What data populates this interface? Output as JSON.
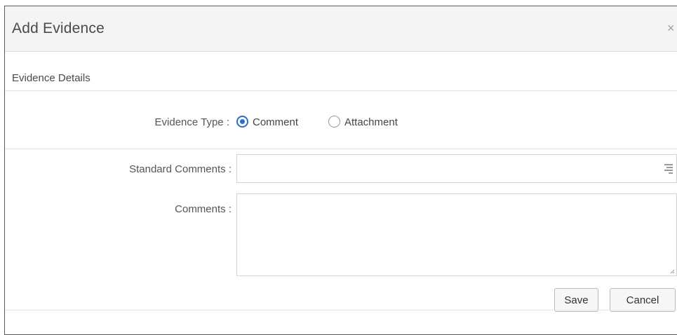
{
  "dialog": {
    "title": "Add Evidence",
    "close_glyph": "×",
    "section_title": "Evidence Details"
  },
  "evidence_type": {
    "label": "Evidence Type :",
    "options": [
      {
        "label": "Comment",
        "selected": true
      },
      {
        "label": "Attachment",
        "selected": false
      }
    ]
  },
  "standard_comments": {
    "label": "Standard Comments :",
    "value": "",
    "icon": "list-filter-icon"
  },
  "comments": {
    "label": "Comments :",
    "value": ""
  },
  "buttons": {
    "save": "Save",
    "cancel": "Cancel"
  },
  "colors": {
    "accent": "#2d6fc6",
    "header_bg": "#f4f4f4",
    "border": "#d3d3d3"
  }
}
